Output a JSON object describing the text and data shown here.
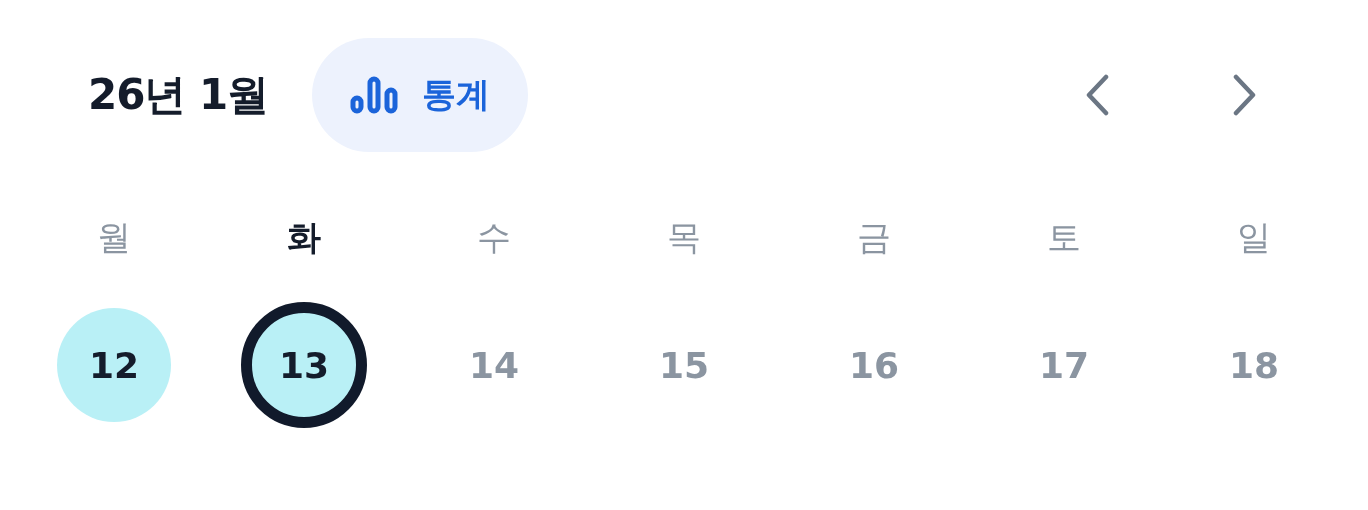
{
  "header": {
    "title": "26년 1월",
    "stats_button": {
      "label": "통계"
    }
  },
  "weekdays": [
    {
      "label": "월",
      "current": false
    },
    {
      "label": "화",
      "current": true
    },
    {
      "label": "수",
      "current": false
    },
    {
      "label": "목",
      "current": false
    },
    {
      "label": "금",
      "current": false
    },
    {
      "label": "토",
      "current": false
    },
    {
      "label": "일",
      "current": false
    }
  ],
  "dates": [
    {
      "label": "12",
      "filled": true,
      "selected": false
    },
    {
      "label": "13",
      "filled": true,
      "selected": true
    },
    {
      "label": "14",
      "filled": false,
      "selected": false
    },
    {
      "label": "15",
      "filled": false,
      "selected": false
    },
    {
      "label": "16",
      "filled": false,
      "selected": false
    },
    {
      "label": "17",
      "filled": false,
      "selected": false
    },
    {
      "label": "18",
      "filled": false,
      "selected": false
    }
  ]
}
